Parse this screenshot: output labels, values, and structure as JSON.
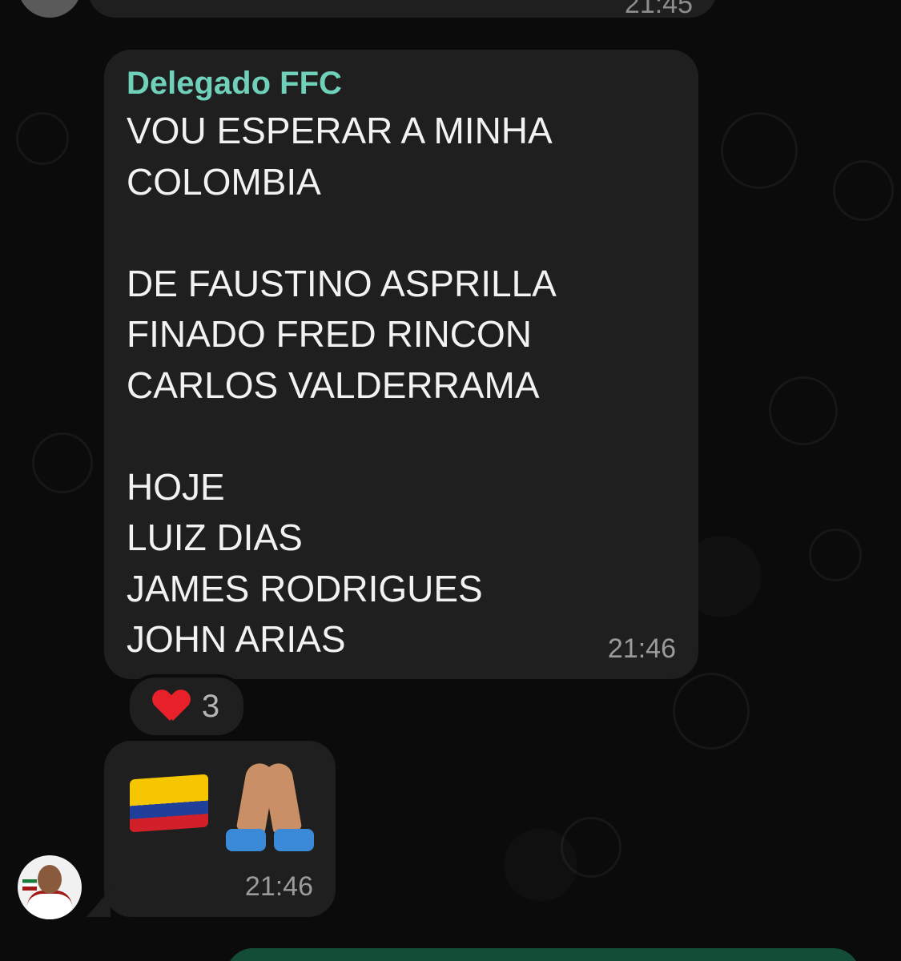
{
  "messages": {
    "top_time": "21:45",
    "main": {
      "sender": "Delegado FFC",
      "text": "VOU ESPERAR A MINHA\nCOLOMBIA\n\nDE FAUSTINO ASPRILLA\nFINADO FRED RINCON\nCARLOS VALDERRAMA\n\nHOJE\nLUIZ DIAS\nJAMES RODRIGUES\nJOHN ARIAS",
      "time": "21:46"
    },
    "reaction": {
      "icon": "heart-icon",
      "count": "3"
    },
    "emoji_message": {
      "icons": [
        "colombia-flag-icon",
        "praying-hands-icon"
      ],
      "time": "21:46"
    }
  },
  "colors": {
    "background": "#0b0b0b",
    "bubble": "#1f1f1f",
    "sender_name": "#6fd1b9",
    "outgoing_bubble": "#144d37"
  }
}
